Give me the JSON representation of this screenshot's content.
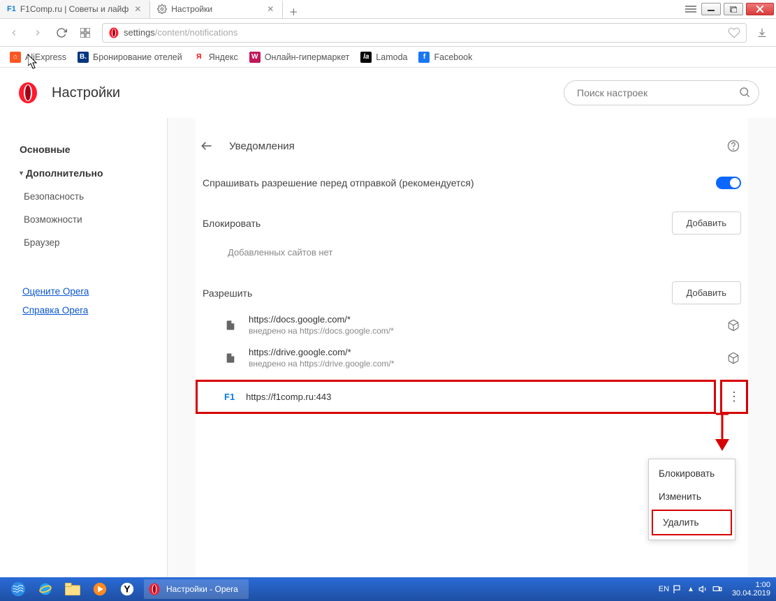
{
  "tabs": {
    "tab1": "F1Comp.ru | Советы и лайф",
    "tab2": "Настройки"
  },
  "address": {
    "host": "settings",
    "path": "/content/notifications"
  },
  "bookmarks": {
    "aliexpress": "AliExpress",
    "booking": "Бронирование отелей",
    "yandex": "Яндекс",
    "hyper": "Онлайн-гипермаркет",
    "lamoda": "Lamoda",
    "facebook": "Facebook"
  },
  "header": {
    "title": "Настройки",
    "search_placeholder": "Поиск настроек"
  },
  "sidebar": {
    "main": "Основные",
    "advanced": "Дополнительно",
    "security": "Безопасность",
    "features": "Возможности",
    "browser": "Браузер",
    "rate": "Оцените Opera",
    "help": "Справка Opera"
  },
  "section": {
    "title": "Уведомления",
    "ask_label": "Спрашивать разрешение перед отправкой (рекомендуется)",
    "block_title": "Блокировать",
    "add_btn": "Добавить",
    "block_empty": "Добавленных сайтов нет",
    "allow_title": "Разрешить",
    "sites": [
      {
        "url": "https://docs.google.com/*",
        "sub": "внедрено на https://docs.google.com/*"
      },
      {
        "url": "https://drive.google.com/*",
        "sub": "внедрено на https://drive.google.com/*"
      }
    ],
    "f1_site": "https://f1comp.ru:443"
  },
  "ctx": {
    "block": "Блокировать",
    "edit": "Изменить",
    "delete": "Удалить"
  },
  "taskbar": {
    "task": "Настройки - Opera",
    "lang": "EN",
    "time": "1:00",
    "date": "30.04.2019"
  }
}
